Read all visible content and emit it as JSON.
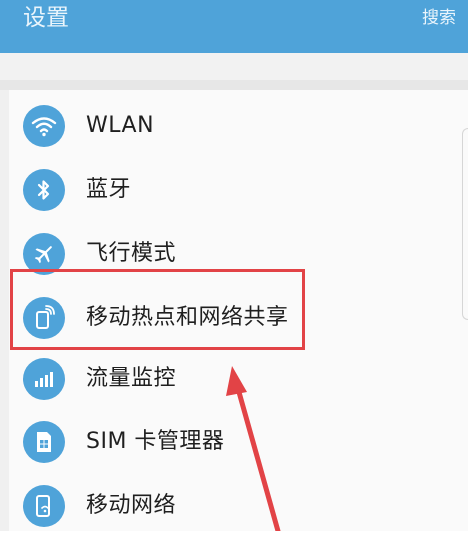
{
  "header": {
    "title": "设置",
    "search_label": "搜索"
  },
  "colors": {
    "accent": "#4fa3d9",
    "highlight": "#e24346"
  },
  "items": [
    {
      "label": "WLAN",
      "icon": "wifi-icon"
    },
    {
      "label": "蓝牙",
      "icon": "bluetooth-icon"
    },
    {
      "label": "飞行模式",
      "icon": "airplane-icon"
    },
    {
      "label": "移动热点和网络共享",
      "icon": "hotspot-icon"
    },
    {
      "label": "流量监控",
      "icon": "data-usage-icon"
    },
    {
      "label": "SIM 卡管理器",
      "icon": "sim-card-icon"
    },
    {
      "label": "移动网络",
      "icon": "mobile-network-icon"
    }
  ]
}
